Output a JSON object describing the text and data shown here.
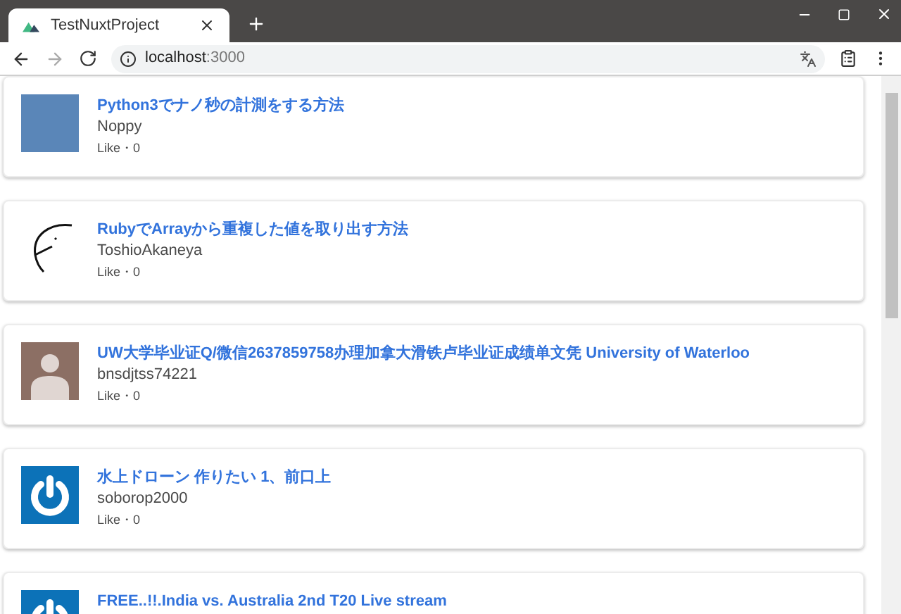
{
  "browser": {
    "tab_title": "TestNuxtProject",
    "url_host": "localhost",
    "url_port": ":3000"
  },
  "posts": [
    {
      "kind": "photo",
      "title": "Python3でナノ秒の計測をする方法",
      "author": "Noppy",
      "like": "Like・0"
    },
    {
      "kind": "bird",
      "title": "RubyでArrayから重複した値を取り出す方法",
      "author": "ToshioAkaneya",
      "like": "Like・0"
    },
    {
      "kind": "person",
      "title": "UW大学毕业证Q/微信2637859758办理加拿大滑铁卢毕业证成绩单文凭 University of Waterloo",
      "author": "bnsdjtss74221",
      "like": "Like・0"
    },
    {
      "kind": "power",
      "title": "水上ドローン 作りたい 1、前口上",
      "author": "soborop2000",
      "like": "Like・0"
    },
    {
      "kind": "power",
      "title": "FREE..!!.India vs. Australia 2nd T20 Live stream"
    }
  ]
}
